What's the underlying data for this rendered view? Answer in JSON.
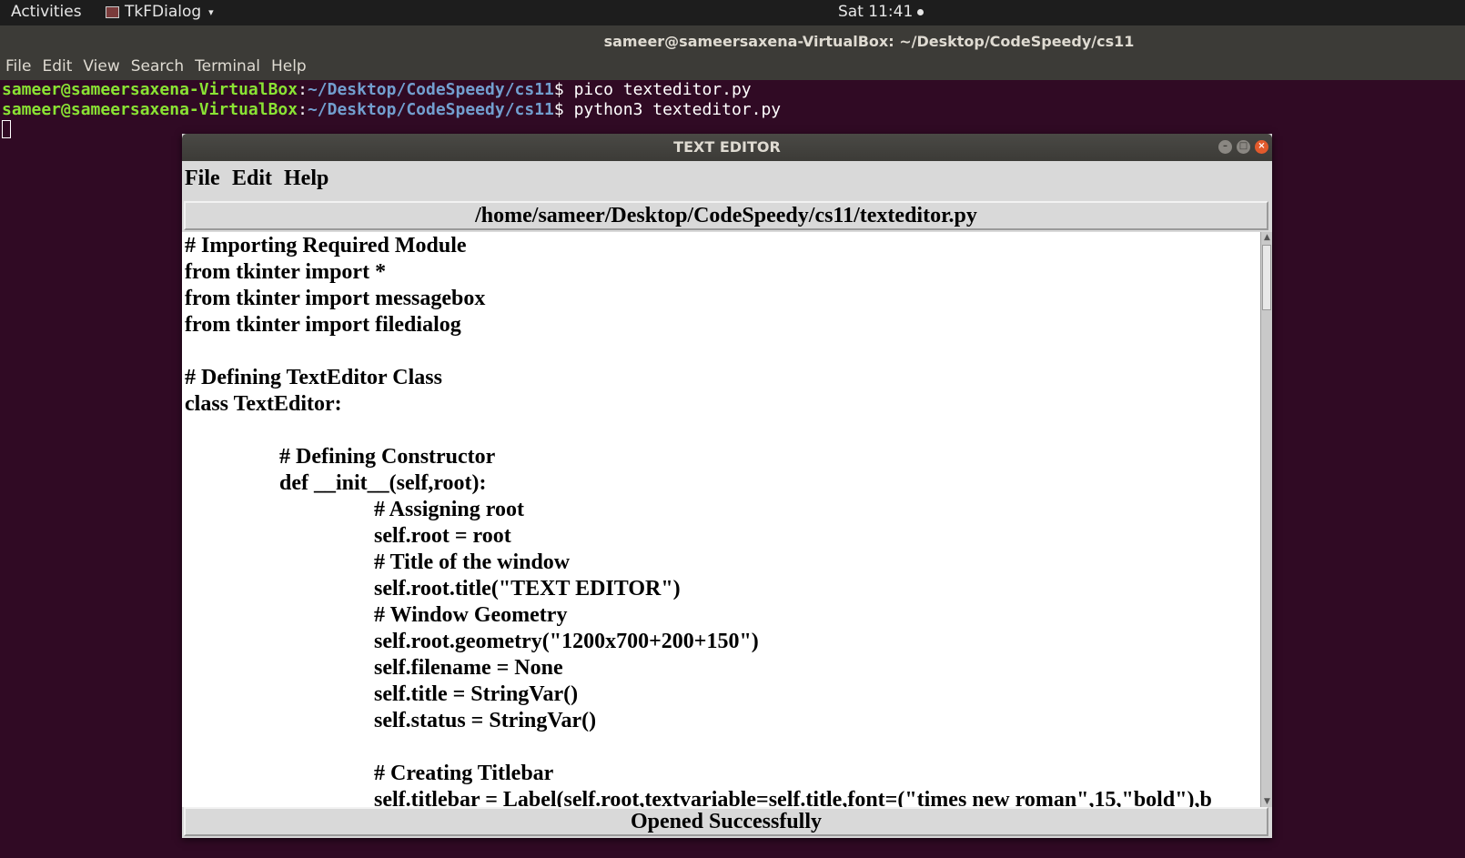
{
  "topbar": {
    "activities": "Activities",
    "app_name": "TkFDialog",
    "clock": "Sat 11:41"
  },
  "terminal": {
    "title": "sameer@sameersaxena-VirtualBox: ~/Desktop/CodeSpeedy/cs11",
    "menu": [
      "File",
      "Edit",
      "View",
      "Search",
      "Terminal",
      "Help"
    ],
    "lines": [
      {
        "user": "sameer@sameersaxena-VirtualBox",
        "sep": ":",
        "path": "~/Desktop/CodeSpeedy/cs11",
        "cmd": "$ pico texteditor.py"
      },
      {
        "user": "sameer@sameersaxena-VirtualBox",
        "sep": ":",
        "path": "~/Desktop/CodeSpeedy/cs11",
        "cmd": "$ python3 texteditor.py"
      }
    ]
  },
  "editor": {
    "window_title": "TEXT EDITOR",
    "menu": [
      "File",
      "Edit",
      "Help"
    ],
    "path": "/home/sameer/Desktop/CodeSpeedy/cs11/texteditor.py",
    "status": "Opened Successfully",
    "code_lines": [
      "# Importing Required Module",
      "from tkinter import *",
      "from tkinter import messagebox",
      "from tkinter import filedialog",
      "",
      "# Defining TextEditor Class",
      "class TextEditor:",
      "",
      "# Defining Constructor",
      "def __init__(self,root):",
      "# Assigning root",
      "self.root = root",
      "# Title of the window",
      "self.root.title(\"TEXT EDITOR\")",
      "# Window Geometry",
      "self.root.geometry(\"1200x700+200+150\")",
      "self.filename = None",
      "self.title = StringVar()",
      "self.status = StringVar()",
      "",
      "# Creating Titlebar",
      "self.titlebar = Label(self.root,textvariable=self.title,font=(\"times new roman\",15,\"bold\"),b"
    ]
  }
}
